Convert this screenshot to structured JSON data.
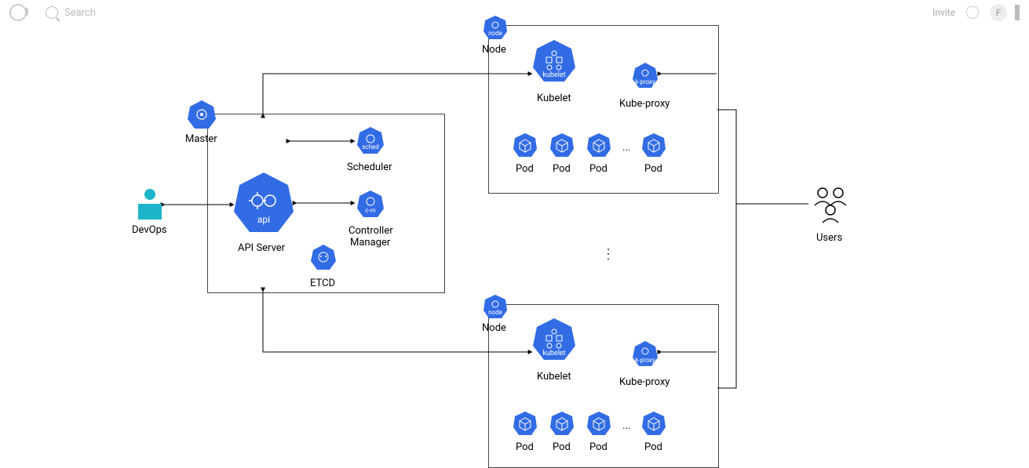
{
  "topbar": {
    "search_placeholder": "Search",
    "invite": "Invite",
    "avatar_initial": "F"
  },
  "colors": {
    "k8s_blue": "#326CE5",
    "teal": "#1CB5C9"
  },
  "labels": {
    "devops": "DevOps",
    "master": "Master",
    "api_server": "API Server",
    "scheduler": "Scheduler",
    "controller_manager_l1": "Controller",
    "controller_manager_l2": "Manager",
    "etcd": "ETCD",
    "node": "Node",
    "kubelet": "Kubelet",
    "kubeproxy": "Kube-proxy",
    "pod": "Pod",
    "pod_ellipsis": "...",
    "users": "Users",
    "vertical_ellipsis": "⋮"
  },
  "hept_texts": {
    "api": "api",
    "sched": "sched",
    "cm": "c-m",
    "node": "node",
    "kubelet": "kubelet",
    "kproxy": "k-proxy"
  }
}
